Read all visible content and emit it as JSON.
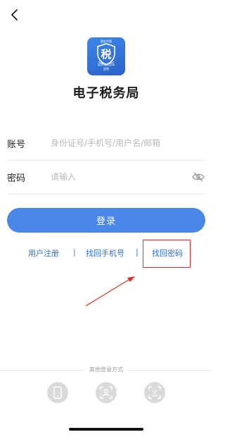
{
  "header": {
    "back_icon": "chevron-left-icon"
  },
  "logo": {
    "top_text": "税务中国",
    "center_char": "税",
    "bottom_text_line1": "国家税务总局",
    "bottom_text_line2": "监制",
    "brand_color": "#3f86e8"
  },
  "app_title": "电子税务局",
  "form": {
    "account_label": "账号",
    "account_placeholder": "身份证号/手机号/用户名/邮箱",
    "password_label": "密码",
    "password_placeholder": "请输入",
    "eye_icon": "eye-hidden-icon"
  },
  "login_button_label": "登录",
  "links": {
    "register": "用户注册",
    "separator": "|",
    "find_phone": "找回手机号",
    "find_password": "找回密码"
  },
  "other_login": {
    "label": "其他登录方式",
    "icons": [
      "phone-icon",
      "face-portrait-icon",
      "face-scan-icon"
    ]
  },
  "colors": {
    "accent": "#4a86e8",
    "link": "#2f6fd6",
    "highlight": "#e5302a"
  }
}
